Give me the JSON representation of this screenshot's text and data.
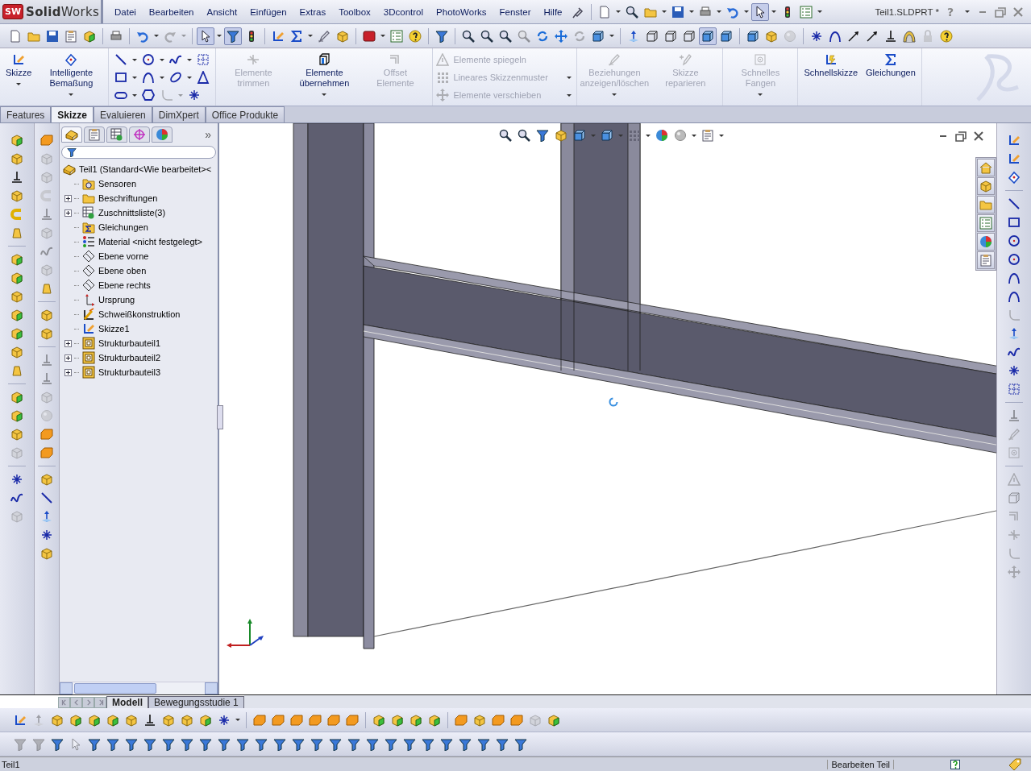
{
  "window": {
    "logo_badge": "SW",
    "logo": "**Solid**Works",
    "title": "Teil1.SLDPRT *",
    "help": "?"
  },
  "menu": [
    "Datei",
    "Bearbeiten",
    "Ansicht",
    "Einfügen",
    "Extras",
    "Toolbox",
    "3Dcontrol",
    "PhotoWorks",
    "Fenster",
    "Hilfe"
  ],
  "quick_toolbar": [
    {
      "kind": "pin",
      "disabled": false,
      "pressed": false
    },
    {
      "kind": "sep"
    },
    {
      "kind": "doc",
      "disabled": false,
      "pressed": false
    },
    {
      "kind": "caret",
      "disabled": false
    },
    {
      "kind": "zoom",
      "disabled": false,
      "pressed": false
    },
    {
      "kind": "folder",
      "disabled": false,
      "pressed": false
    },
    {
      "kind": "caret",
      "disabled": false
    },
    {
      "kind": "save",
      "disabled": false,
      "pressed": false
    },
    {
      "kind": "caret",
      "disabled": false
    },
    {
      "kind": "print",
      "disabled": false,
      "pressed": false
    },
    {
      "kind": "caret",
      "disabled": false
    },
    {
      "kind": "undo",
      "disabled": false,
      "pressed": false
    },
    {
      "kind": "caret",
      "disabled": false
    },
    {
      "kind": "pointer",
      "disabled": false,
      "pressed": true
    },
    {
      "kind": "caret",
      "disabled": false
    },
    {
      "kind": "light",
      "disabled": false,
      "pressed": false
    },
    {
      "kind": "list",
      "disabled": false,
      "pressed": false
    },
    {
      "kind": "caret",
      "disabled": false
    }
  ],
  "standard_toolbar": [
    {
      "kind": "doc",
      "disabled": false,
      "pressed": false
    },
    {
      "kind": "folder",
      "disabled": false,
      "pressed": false
    },
    {
      "kind": "save",
      "disabled": false,
      "pressed": false
    },
    {
      "kind": "note",
      "disabled": false,
      "pressed": false
    },
    {
      "kind": "gcube",
      "disabled": false,
      "pressed": false
    },
    {
      "kind": "sep"
    },
    {
      "kind": "print",
      "disabled": false,
      "pressed": false
    },
    {
      "kind": "sep"
    },
    {
      "kind": "undo",
      "disabled": false,
      "pressed": false
    },
    {
      "kind": "caret",
      "disabled": false
    },
    {
      "kind": "redo",
      "disabled": true,
      "pressed": false
    },
    {
      "kind": "caret",
      "disabled": true
    },
    {
      "kind": "sep"
    },
    {
      "kind": "pointer",
      "disabled": false,
      "pressed": true
    },
    {
      "kind": "caret",
      "disabled": false
    },
    {
      "kind": "funnel",
      "disabled": false,
      "pressed": true
    },
    {
      "kind": "light",
      "disabled": false,
      "pressed": false
    },
    {
      "kind": "sep"
    },
    {
      "kind": "sketch",
      "disabled": false,
      "pressed": false
    },
    {
      "kind": "sigma",
      "disabled": false,
      "pressed": false
    },
    {
      "kind": "caret",
      "disabled": false
    },
    {
      "kind": "relation",
      "disabled": false,
      "pressed": false
    },
    {
      "kind": "cube",
      "disabled": false,
      "pressed": false
    },
    {
      "kind": "sep"
    },
    {
      "kind": "redbox",
      "disabled": false,
      "pressed": false
    },
    {
      "kind": "caret",
      "disabled": false
    },
    {
      "kind": "list",
      "disabled": false,
      "pressed": false
    },
    {
      "kind": "help",
      "disabled": false,
      "pressed": false
    },
    {
      "kind": "sep"
    },
    {
      "kind": "funnel",
      "disabled": false,
      "pressed": false
    },
    {
      "kind": "sep"
    },
    {
      "kind": "zoom",
      "disabled": false,
      "pressed": false
    },
    {
      "kind": "zoom",
      "disabled": false,
      "pressed": false
    },
    {
      "kind": "zoom",
      "disabled": false,
      "pressed": false
    },
    {
      "kind": "zoom",
      "disabled": true,
      "pressed": false
    },
    {
      "kind": "rotate",
      "disabled": false,
      "pressed": false
    },
    {
      "kind": "move",
      "disabled": false,
      "pressed": false
    },
    {
      "kind": "rotate",
      "disabled": true,
      "pressed": false
    },
    {
      "kind": "shaded",
      "disabled": false,
      "pressed": false
    },
    {
      "kind": "caret",
      "disabled": false
    },
    {
      "kind": "sep"
    },
    {
      "kind": "axis",
      "disabled": false,
      "pressed": false
    },
    {
      "kind": "wire",
      "disabled": false,
      "pressed": false
    },
    {
      "kind": "wire",
      "disabled": false,
      "pressed": false
    },
    {
      "kind": "wire",
      "disabled": false,
      "pressed": false
    },
    {
      "kind": "shaded",
      "disabled": false,
      "pressed": true
    },
    {
      "kind": "shaded",
      "disabled": false,
      "pressed": false
    },
    {
      "kind": "sep"
    },
    {
      "kind": "shaded",
      "disabled": false,
      "pressed": false
    },
    {
      "kind": "cube",
      "disabled": false,
      "pressed": false
    },
    {
      "kind": "sphere",
      "disabled": true,
      "pressed": false
    },
    {
      "kind": "sep"
    },
    {
      "kind": "point",
      "disabled": false,
      "pressed": false
    },
    {
      "kind": "arc",
      "disabled": false,
      "pressed": false
    },
    {
      "kind": "arrow",
      "disabled": false,
      "pressed": false
    },
    {
      "kind": "arrow",
      "disabled": false,
      "pressed": false
    },
    {
      "kind": "ground",
      "disabled": false,
      "pressed": false
    },
    {
      "kind": "dome",
      "disabled": false,
      "pressed": false
    },
    {
      "kind": "lock",
      "disabled": true,
      "pressed": false
    },
    {
      "kind": "help",
      "disabled": false,
      "pressed": false
    }
  ],
  "ribbon": [
    {
      "kind": "large",
      "buttons": [
        {
          "label": "Skizze",
          "kind": "sketch",
          "disabled": false,
          "dropdown": true
        },
        {
          "label": "Intelligente Bemaßung",
          "kind": "dim",
          "disabled": false,
          "dropdown": true
        }
      ]
    },
    {
      "kind": "grid",
      "rows": [
        [
          {
            "kind": "line",
            "disabled": false
          },
          {
            "kind": "caret",
            "disabled": false
          },
          {
            "kind": "circle",
            "disabled": false
          },
          {
            "kind": "caret",
            "disabled": false
          },
          {
            "kind": "spline",
            "disabled": false
          },
          {
            "kind": "caret",
            "disabled": false
          },
          {
            "kind": "grid",
            "disabled": false
          }
        ],
        [
          {
            "kind": "rect",
            "disabled": false
          },
          {
            "kind": "caret",
            "disabled": false
          },
          {
            "kind": "arc",
            "disabled": false
          },
          {
            "kind": "caret",
            "disabled": false
          },
          {
            "kind": "ellipse",
            "disabled": false
          },
          {
            "kind": "caret",
            "disabled": false
          },
          {
            "kind": "triangle",
            "disabled": false
          }
        ],
        [
          {
            "kind": "slot",
            "disabled": false
          },
          {
            "kind": "caret",
            "disabled": false
          },
          {
            "kind": "hexagon",
            "disabled": false
          },
          {
            "kind": "fillet",
            "disabled": true
          },
          {
            "kind": "caret",
            "disabled": true
          },
          {
            "kind": "point",
            "disabled": false
          }
        ]
      ]
    },
    {
      "kind": "large",
      "buttons": [
        {
          "label": "Elemente trimmen",
          "kind": "trim",
          "disabled": true,
          "dropdown": false
        },
        {
          "label": "Elemente übernehmen",
          "kind": "convert",
          "disabled": false,
          "dropdown": true
        },
        {
          "label": "Offset Elemente",
          "kind": "offset",
          "disabled": true,
          "dropdown": false
        }
      ]
    },
    {
      "kind": "list",
      "buttons": [
        {
          "label": "Elemente spiegeln",
          "kind": "warn",
          "disabled": true,
          "dropdown": false
        },
        {
          "label": "Lineares Skizzenmuster",
          "kind": "dots",
          "disabled": true,
          "dropdown": true
        },
        {
          "label": "Elemente verschieben",
          "kind": "move",
          "disabled": true,
          "dropdown": true
        }
      ]
    },
    {
      "kind": "large",
      "buttons": [
        {
          "label": "Beziehungen anzeigen/löschen",
          "kind": "relation",
          "disabled": true,
          "dropdown": true
        },
        {
          "label": "Skizze reparieren",
          "kind": "repair",
          "disabled": true,
          "dropdown": false
        }
      ]
    },
    {
      "kind": "large",
      "buttons": [
        {
          "label": "Schnelles Fangen",
          "kind": "snap",
          "disabled": true,
          "dropdown": true
        }
      ]
    },
    {
      "kind": "large",
      "buttons": [
        {
          "label": "Schnellskizze",
          "kind": "quick",
          "disabled": false,
          "dropdown": false
        },
        {
          "label": "Gleichungen",
          "kind": "sigma",
          "disabled": false,
          "dropdown": false
        }
      ]
    }
  ],
  "command_tabs": [
    {
      "label": "Features",
      "selected": false
    },
    {
      "label": "Skizze",
      "selected": true
    },
    {
      "label": "Evaluieren",
      "selected": false
    },
    {
      "label": "DimXpert",
      "selected": false
    },
    {
      "label": "Office Produkte",
      "selected": false
    }
  ],
  "left_toolbar_1": [
    {
      "kind": "gcube",
      "disabled": false,
      "pressed": false
    },
    {
      "kind": "cube",
      "disabled": false,
      "pressed": false
    },
    {
      "kind": "ground",
      "disabled": false,
      "pressed": false
    },
    {
      "kind": "cube",
      "disabled": false,
      "pressed": false
    },
    {
      "kind": "magnet",
      "disabled": false,
      "pressed": false
    },
    {
      "kind": "bell",
      "disabled": false,
      "pressed": false
    },
    {
      "kind": "sep"
    },
    {
      "kind": "gcube",
      "disabled": false,
      "pressed": false
    },
    {
      "kind": "gcube",
      "disabled": false,
      "pressed": false
    },
    {
      "kind": "cube",
      "disabled": false,
      "pressed": false
    },
    {
      "kind": "gcube",
      "disabled": false,
      "pressed": false
    },
    {
      "kind": "gcube",
      "disabled": false,
      "pressed": false
    },
    {
      "kind": "cube",
      "disabled": false,
      "pressed": false
    },
    {
      "kind": "bell",
      "disabled": false,
      "pressed": false
    },
    {
      "kind": "sep"
    },
    {
      "kind": "gcube",
      "disabled": false,
      "pressed": false
    },
    {
      "kind": "gcube",
      "disabled": false,
      "pressed": false
    },
    {
      "kind": "cube",
      "disabled": false,
      "pressed": false
    },
    {
      "kind": "cube",
      "disabled": true,
      "pressed": false
    },
    {
      "kind": "sep"
    },
    {
      "kind": "point",
      "disabled": false,
      "pressed": false
    },
    {
      "kind": "spline",
      "disabled": false,
      "pressed": false
    },
    {
      "kind": "cube",
      "disabled": true,
      "pressed": false
    }
  ],
  "left_toolbar_2": [
    {
      "kind": "block",
      "disabled": false,
      "pressed": false
    },
    {
      "kind": "cube",
      "disabled": true,
      "pressed": false
    },
    {
      "kind": "cube",
      "disabled": true,
      "pressed": false
    },
    {
      "kind": "magnet",
      "disabled": true,
      "pressed": false
    },
    {
      "kind": "ground",
      "disabled": true,
      "pressed": false
    },
    {
      "kind": "cube",
      "disabled": true,
      "pressed": false
    },
    {
      "kind": "spline",
      "disabled": true,
      "pressed": false
    },
    {
      "kind": "cube",
      "disabled": true,
      "pressed": false
    },
    {
      "kind": "bell",
      "disabled": false,
      "pressed": false
    },
    {
      "kind": "sep"
    },
    {
      "kind": "cube",
      "disabled": false,
      "pressed": false
    },
    {
      "kind": "cube",
      "disabled": false,
      "pressed": false
    },
    {
      "kind": "sep"
    },
    {
      "kind": "ground",
      "disabled": true,
      "pressed": false
    },
    {
      "kind": "ground",
      "disabled": true,
      "pressed": false
    },
    {
      "kind": "cube",
      "disabled": true,
      "pressed": false
    },
    {
      "kind": "sphere",
      "disabled": true,
      "pressed": false
    },
    {
      "kind": "block",
      "disabled": false,
      "pressed": false
    },
    {
      "kind": "block",
      "disabled": false,
      "pressed": false
    },
    {
      "kind": "sep"
    },
    {
      "kind": "cube",
      "disabled": false,
      "pressed": false
    },
    {
      "kind": "line",
      "disabled": false,
      "pressed": false
    },
    {
      "kind": "axis",
      "disabled": false,
      "pressed": false
    },
    {
      "kind": "point",
      "disabled": false,
      "pressed": false
    },
    {
      "kind": "cube",
      "disabled": false,
      "pressed": false
    }
  ],
  "panel_tabs": [
    {
      "kind": "part",
      "selected": true
    },
    {
      "kind": "note",
      "selected": false
    },
    {
      "kind": "table",
      "selected": false
    },
    {
      "kind": "target",
      "selected": false
    },
    {
      "kind": "pie",
      "selected": false
    }
  ],
  "panel_more": "»",
  "tree": {
    "label": "Teil1  (Standard<Wie bearbeitet><",
    "kind": "part",
    "children": [
      {
        "label": "Sensoren",
        "kind": "sensor",
        "expandable": false
      },
      {
        "label": "Beschriftungen",
        "kind": "folder",
        "expandable": true
      },
      {
        "label": "Zuschnittsliste(3)",
        "kind": "table",
        "expandable": true
      },
      {
        "label": "Gleichungen",
        "kind": "sigmafolder",
        "expandable": false
      },
      {
        "label": "Material <nicht festgelegt>",
        "kind": "matl",
        "expandable": false
      },
      {
        "label": "Ebene vorne",
        "kind": "plane",
        "expandable": false
      },
      {
        "label": "Ebene oben",
        "kind": "plane",
        "expandable": false
      },
      {
        "label": "Ebene rechts",
        "kind": "plane",
        "expandable": false
      },
      {
        "label": "Ursprung",
        "kind": "origin",
        "expandable": false
      },
      {
        "label": "Schweißkonstruktion",
        "kind": "weld",
        "expandable": false
      },
      {
        "label": "Skizze1",
        "kind": "sketch",
        "expandable": false
      },
      {
        "label": "Strukturbauteil1",
        "kind": "member",
        "expandable": true
      },
      {
        "label": "Strukturbauteil2",
        "kind": "member",
        "expandable": true
      },
      {
        "label": "Strukturbauteil3",
        "kind": "member",
        "expandable": true
      }
    ]
  },
  "view_toolbar": [
    {
      "kind": "zoom",
      "disabled": false,
      "pressed": false
    },
    {
      "kind": "zoom",
      "disabled": false,
      "pressed": false
    },
    {
      "kind": "funnel",
      "disabled": false,
      "pressed": false
    },
    {
      "kind": "cube",
      "disabled": false,
      "pressed": false
    },
    {
      "kind": "shaded",
      "disabled": false,
      "pressed": false
    },
    {
      "kind": "caret",
      "disabled": false
    },
    {
      "kind": "shaded",
      "disabled": false,
      "pressed": false
    },
    {
      "kind": "caret",
      "disabled": false
    },
    {
      "kind": "dots",
      "disabled": false,
      "pressed": false
    },
    {
      "kind": "caret",
      "disabled": false
    },
    {
      "kind": "pie",
      "disabled": false,
      "pressed": false
    },
    {
      "kind": "sphere",
      "disabled": false,
      "pressed": false
    },
    {
      "kind": "caret",
      "disabled": false
    },
    {
      "kind": "note",
      "disabled": false,
      "pressed": false
    },
    {
      "kind": "caret",
      "disabled": false
    }
  ],
  "task_pane": [
    {
      "kind": "home",
      "selected": false
    },
    {
      "kind": "cube",
      "selected": false
    },
    {
      "kind": "folder",
      "selected": false
    },
    {
      "kind": "list",
      "selected": false
    },
    {
      "kind": "pie",
      "selected": false
    },
    {
      "kind": "note",
      "selected": false
    }
  ],
  "right_toolbar": [
    {
      "kind": "sketch",
      "disabled": false,
      "pressed": false
    },
    {
      "kind": "sketch",
      "disabled": false,
      "pressed": false
    },
    {
      "kind": "dim",
      "disabled": false,
      "pressed": false
    },
    {
      "kind": "sep"
    },
    {
      "kind": "line",
      "disabled": false,
      "pressed": false
    },
    {
      "kind": "rect",
      "disabled": false,
      "pressed": false
    },
    {
      "kind": "circle",
      "disabled": false,
      "pressed": false
    },
    {
      "kind": "circle",
      "disabled": false,
      "pressed": false
    },
    {
      "kind": "arc",
      "disabled": false,
      "pressed": false
    },
    {
      "kind": "arc",
      "disabled": false,
      "pressed": false
    },
    {
      "kind": "fillet",
      "disabled": true,
      "pressed": false
    },
    {
      "kind": "axis",
      "disabled": false,
      "pressed": false
    },
    {
      "kind": "spline",
      "disabled": false,
      "pressed": false
    },
    {
      "kind": "point",
      "disabled": false,
      "pressed": false
    },
    {
      "kind": "grid",
      "disabled": false,
      "pressed": false
    },
    {
      "kind": "sep"
    },
    {
      "kind": "ground",
      "disabled": true,
      "pressed": false
    },
    {
      "kind": "relation",
      "disabled": true,
      "pressed": false
    },
    {
      "kind": "snap",
      "disabled": true,
      "pressed": false
    },
    {
      "kind": "sep"
    },
    {
      "kind": "warn",
      "disabled": true,
      "pressed": false
    },
    {
      "kind": "wire",
      "disabled": true,
      "pressed": false
    },
    {
      "kind": "offset",
      "disabled": true,
      "pressed": false
    },
    {
      "kind": "trim",
      "disabled": true,
      "pressed": false
    },
    {
      "kind": "fillet",
      "disabled": true,
      "pressed": false
    },
    {
      "kind": "move",
      "disabled": true,
      "pressed": false
    }
  ],
  "model_tabs": [
    {
      "label": "Modell",
      "selected": true
    },
    {
      "label": "Bewegungsstudie 1",
      "selected": false
    }
  ],
  "bottom_toolbar_1": [
    {
      "kind": "sketch",
      "disabled": false,
      "pressed": false
    },
    {
      "kind": "axis",
      "disabled": true,
      "pressed": false
    },
    {
      "kind": "cube",
      "disabled": false,
      "pressed": false
    },
    {
      "kind": "gcube",
      "disabled": false,
      "pressed": false
    },
    {
      "kind": "gcube",
      "disabled": false,
      "pressed": false
    },
    {
      "kind": "gcube",
      "disabled": false,
      "pressed": false
    },
    {
      "kind": "cube",
      "disabled": false,
      "pressed": false
    },
    {
      "kind": "ground",
      "disabled": false,
      "pressed": false
    },
    {
      "kind": "cube",
      "disabled": false,
      "pressed": false
    },
    {
      "kind": "cube",
      "disabled": false,
      "pressed": false
    },
    {
      "kind": "gcube",
      "disabled": false,
      "pressed": false
    },
    {
      "kind": "point",
      "disabled": false,
      "pressed": false
    },
    {
      "kind": "caret",
      "disabled": false
    },
    {
      "kind": "sep"
    },
    {
      "kind": "block",
      "disabled": false,
      "pressed": false
    },
    {
      "kind": "block",
      "disabled": false,
      "pressed": false
    },
    {
      "kind": "block",
      "disabled": false,
      "pressed": false
    },
    {
      "kind": "block",
      "disabled": false,
      "pressed": false
    },
    {
      "kind": "block",
      "disabled": false,
      "pressed": false
    },
    {
      "kind": "block",
      "disabled": false,
      "pressed": false
    },
    {
      "kind": "sep"
    },
    {
      "kind": "gcube",
      "disabled": false,
      "pressed": false
    },
    {
      "kind": "gcube",
      "disabled": false,
      "pressed": false
    },
    {
      "kind": "gcube",
      "disabled": false,
      "pressed": false
    },
    {
      "kind": "gcube",
      "disabled": false,
      "pressed": false
    },
    {
      "kind": "sep"
    },
    {
      "kind": "block",
      "disabled": false,
      "pressed": false
    },
    {
      "kind": "cube",
      "disabled": false,
      "pressed": false
    },
    {
      "kind": "block",
      "disabled": false,
      "pressed": false
    },
    {
      "kind": "block",
      "disabled": false,
      "pressed": false
    },
    {
      "kind": "cube",
      "disabled": true,
      "pressed": false
    },
    {
      "kind": "gcube",
      "disabled": false,
      "pressed": false
    }
  ],
  "bottom_toolbar_2": [
    {
      "kind": "funnel",
      "disabled": true,
      "pressed": false
    },
    {
      "kind": "funnel",
      "disabled": true,
      "pressed": false
    },
    {
      "kind": "funnel",
      "disabled": false,
      "pressed": false
    },
    {
      "kind": "pointer",
      "disabled": true,
      "pressed": false
    },
    {
      "kind": "funnel",
      "disabled": false,
      "pressed": false
    },
    {
      "kind": "funnel",
      "disabled": false,
      "pressed": false
    },
    {
      "kind": "funnel",
      "disabled": false,
      "pressed": false
    },
    {
      "kind": "funnel",
      "disabled": false,
      "pressed": false
    },
    {
      "kind": "funnel",
      "disabled": false,
      "pressed": false
    },
    {
      "kind": "funnel",
      "disabled": false,
      "pressed": false
    },
    {
      "kind": "funnel",
      "disabled": false,
      "pressed": false
    },
    {
      "kind": "funnel",
      "disabled": false,
      "pressed": false
    },
    {
      "kind": "funnel",
      "disabled": false,
      "pressed": false
    },
    {
      "kind": "funnel",
      "disabled": false,
      "pressed": false
    },
    {
      "kind": "funnel",
      "disabled": false,
      "pressed": false
    },
    {
      "kind": "funnel",
      "disabled": false,
      "pressed": false
    },
    {
      "kind": "funnel",
      "disabled": false,
      "pressed": false
    },
    {
      "kind": "funnel",
      "disabled": false,
      "pressed": false
    },
    {
      "kind": "funnel",
      "disabled": false,
      "pressed": false
    },
    {
      "kind": "funnel",
      "disabled": false,
      "pressed": false
    },
    {
      "kind": "funnel",
      "disabled": false,
      "pressed": false
    },
    {
      "kind": "funnel",
      "disabled": false,
      "pressed": false
    },
    {
      "kind": "funnel",
      "disabled": false,
      "pressed": false
    },
    {
      "kind": "funnel",
      "disabled": false,
      "pressed": false
    },
    {
      "kind": "funnel",
      "disabled": false,
      "pressed": false
    },
    {
      "kind": "funnel",
      "disabled": false,
      "pressed": false
    },
    {
      "kind": "funnel",
      "disabled": false,
      "pressed": false
    },
    {
      "kind": "funnel",
      "disabled": false,
      "pressed": false
    }
  ],
  "status_bar": {
    "document": "Teil1",
    "mode": "Bearbeiten Teil"
  }
}
